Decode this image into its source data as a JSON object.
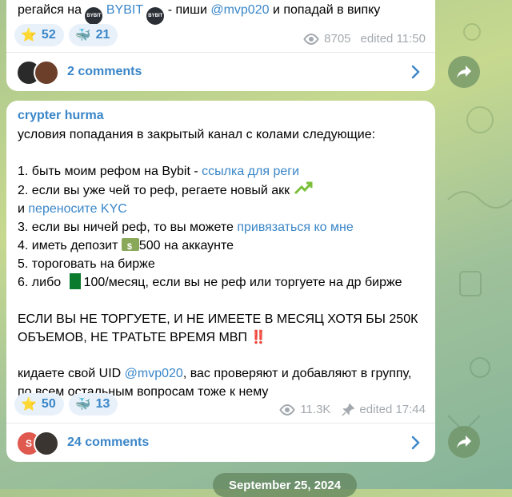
{
  "post1": {
    "line_prefix": "регайся на",
    "bybit_link": "BYBIT",
    "line_middle": " - пиши ",
    "mention": "@mvp020",
    "line_suffix": " и попадай в випку",
    "reactions": [
      {
        "emoji": "⭐",
        "count": "52"
      },
      {
        "emoji": "🐳",
        "count": "21"
      }
    ],
    "views": "8705",
    "edited": "edited 11:50",
    "comments": "2 comments"
  },
  "post2": {
    "author": "crypter hurma",
    "intro": "условия попадания в закрытый канал с колами следующие:",
    "item1_text": "1. быть моим рефом на Bybit - ",
    "item1_link": "ссылка для реги",
    "item2_text": "2. если вы уже чей то реф, регаете новый акк",
    "item2b_prefix": "и ",
    "item2b_link": "переносите KYC",
    "item3_text": "3. если вы ничей реф, то вы можете ",
    "item3_link": "привязаться ко мне",
    "item4_prefix": "4. иметь депозит ",
    "item4_suffix": "500 на аккаунте",
    "item5_text": "5. тороговать на бирже",
    "item6_prefix": "6. либо ",
    "item6_suffix": "100/месяц, если вы не реф или торгуете на др бирже",
    "warning": "ЕСЛИ ВЫ НЕ ТОРГУЕТЕ, И НЕ ИМЕЕТЕ В МЕСЯЦ ХОТЯ БЫ 250К ОБЪЕМОВ, НЕ ТРАТЬТЕ ВРЕМЯ МВП",
    "warning_emoji": "‼️",
    "footer_prefix": "кидаете свой UID ",
    "footer_mention": "@mvp020",
    "footer_suffix": ", вас проверяют и добавляют в группу, по всем остальным вопросам тоже к нему",
    "reactions": [
      {
        "emoji": "⭐",
        "count": "50"
      },
      {
        "emoji": "🐳",
        "count": "13"
      }
    ],
    "views": "11.3K",
    "edited": "edited 17:44",
    "comments": "24 comments",
    "avatar_letter": "S"
  },
  "date_separator": "September 25, 2024",
  "colors": {
    "link": "#3a86c8",
    "reaction_bg": "#e8f1fa",
    "meta": "#a3a9ae",
    "avatar_red": "#e0594f"
  }
}
